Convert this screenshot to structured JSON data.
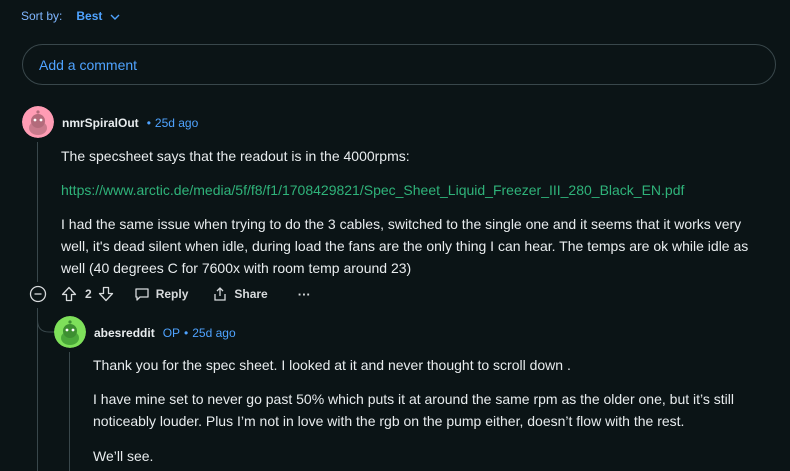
{
  "sort": {
    "label": "Sort by:",
    "value": "Best"
  },
  "add_comment": {
    "placeholder": "Add a comment"
  },
  "comment1": {
    "author": "nmrSpiralOut",
    "time": "25d ago",
    "para1": "The specsheet says that the readout is in the 4000rpms:",
    "link": "https://www.arctic.de/media/5f/f8/f1/1708429821/Spec_Sheet_Liquid_Freezer_III_280_Black_EN.pdf",
    "para2": "I had the same issue when trying to do the 3 cables, switched to the single one and it seems that it works very well, it's dead silent when idle, during load the fans are the only thing I can hear. The temps are ok while idle as well (40 degrees C for 7600x with room temp around 23)",
    "votes": "2",
    "reply_label": "Reply",
    "share_label": "Share",
    "more_label": "···",
    "avatar_color": "#ff9cb4"
  },
  "comment2": {
    "author": "abesreddit",
    "op_badge": "OP",
    "time": "25d ago",
    "para1": "Thank you for the spec sheet. I looked at it and never thought to scroll down .",
    "para2": "I have mine set to never go past 50% which puts it at around the same rpm as the older one, but it’s still noticeably louder. Plus I’m not in love with the rgb on the pump either, doesn’t flow with the rest.",
    "para3": "We’ll see.",
    "avatar_color": "#7ee05a"
  },
  "colors": {
    "background": "#0b1416",
    "accent": "#4fa3ff",
    "link": "#2fb37a",
    "border": "#39474b"
  }
}
